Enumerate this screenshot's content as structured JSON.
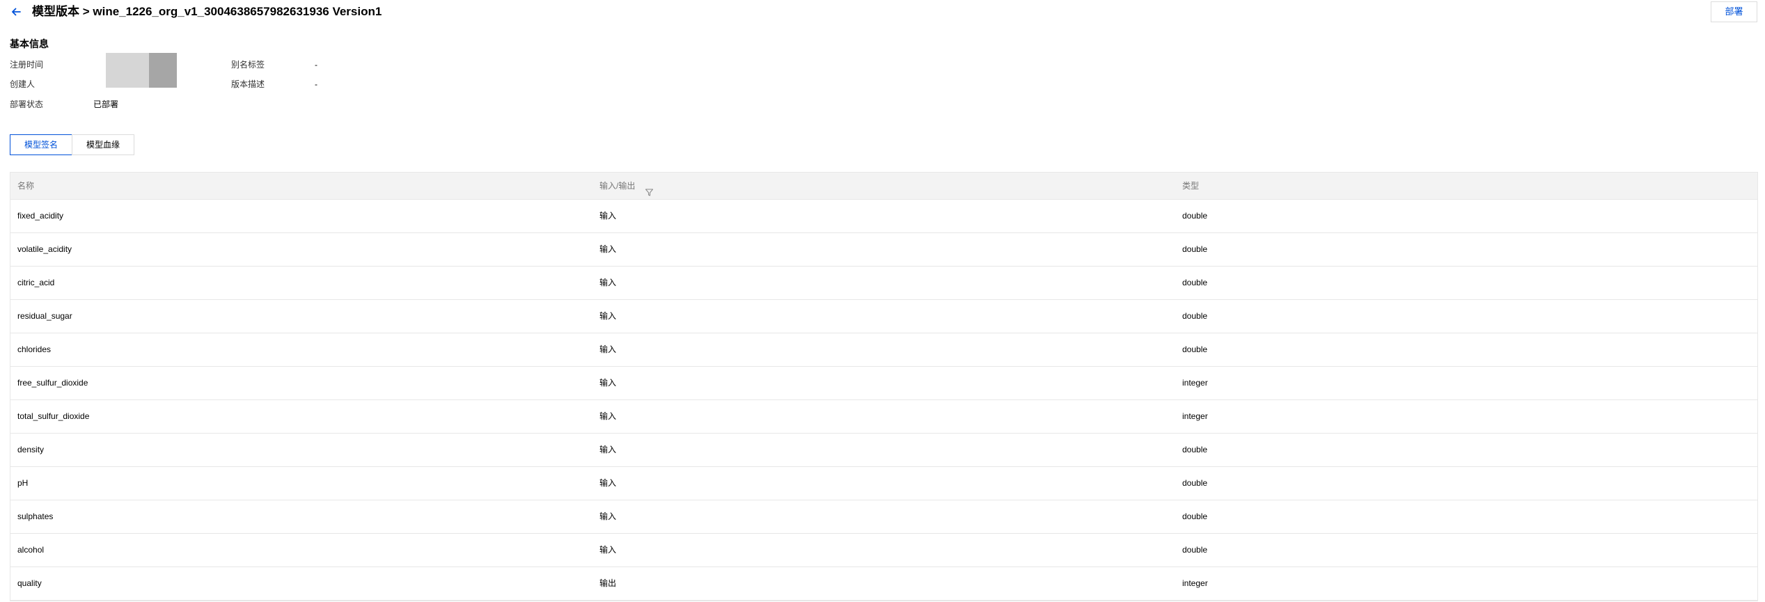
{
  "header": {
    "title": "模型版本 > wine_1226_org_v1_3004638657982631936 Version1",
    "deploy_label": "部署"
  },
  "basic_info": {
    "section_title": "基本信息",
    "registered_time_label": "注册时间",
    "creator_label": "创建人",
    "deploy_status_label": "部署状态",
    "deploy_status_value": "已部署",
    "alias_tag_label": "别名标签",
    "alias_tag_value": "-",
    "version_desc_label": "版本描述",
    "version_desc_value": "-"
  },
  "tabs": [
    {
      "label": "模型签名",
      "active": true
    },
    {
      "label": "模型血缘",
      "active": false
    }
  ],
  "table": {
    "columns": [
      "名称",
      "输入/输出",
      "类型"
    ],
    "rows": [
      {
        "name": "fixed_acidity",
        "io": "输入",
        "type": "double"
      },
      {
        "name": "volatile_acidity",
        "io": "输入",
        "type": "double"
      },
      {
        "name": "citric_acid",
        "io": "输入",
        "type": "double"
      },
      {
        "name": "residual_sugar",
        "io": "输入",
        "type": "double"
      },
      {
        "name": "chlorides",
        "io": "输入",
        "type": "double"
      },
      {
        "name": "free_sulfur_dioxide",
        "io": "输入",
        "type": "integer"
      },
      {
        "name": "total_sulfur_dioxide",
        "io": "输入",
        "type": "integer"
      },
      {
        "name": "density",
        "io": "输入",
        "type": "double"
      },
      {
        "name": "pH",
        "io": "输入",
        "type": "double"
      },
      {
        "name": "sulphates",
        "io": "输入",
        "type": "double"
      },
      {
        "name": "alcohol",
        "io": "输入",
        "type": "double"
      },
      {
        "name": "quality",
        "io": "输出",
        "type": "integer"
      }
    ]
  },
  "icons": {
    "back": "arrow-left-icon",
    "filter": "filter-icon"
  },
  "colors": {
    "accent": "#0052d9",
    "header_bg": "#f3f3f3",
    "border": "#e7e7e7",
    "avatar_light": "#d6d6d6",
    "avatar_dark": "#a6a6a6"
  }
}
